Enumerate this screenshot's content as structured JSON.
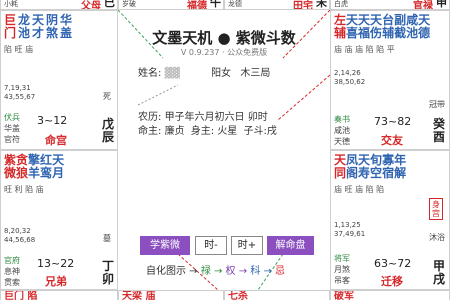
{
  "top_strip": {
    "left_label": "小耗",
    "left_palace": "父母",
    "left_stem": "巳",
    "mid_label": "岁破",
    "mid_palace": "福德",
    "mid_stem": "午",
    "right_label": "龙德",
    "right_palace": "田宅",
    "right_stem": "未",
    "far_label": "白虎",
    "far_palace": "官禄",
    "far_stem": "申"
  },
  "cells": {
    "ming": {
      "stars_red": [
        "巨",
        "门"
      ],
      "stars_blue": [
        "龙",
        "池"
      ],
      "stars_purple": [
        "天",
        "才"
      ],
      "stars_extra1": [
        "阴",
        "煞"
      ],
      "stars_extra2": [
        "华",
        "盖"
      ],
      "bright": "陷 旺    庙",
      "ages": [
        "7,19,31",
        "43,55,67"
      ],
      "right_label": "死",
      "shen1": "伏兵",
      "shen2": "华盖",
      "shen3": "官符",
      "range": "3~12",
      "palace": "命宫",
      "stem": [
        "戊",
        "辰"
      ]
    },
    "xiongdi": {
      "row1": [
        "紫",
        "贪",
        "擎",
        "红",
        "天"
      ],
      "row2": [
        "微",
        "狼",
        "羊",
        "鸾",
        "月"
      ],
      "row3": "旺 利 陷    庙",
      "ages": [
        "8,20,32",
        "44,56,68"
      ],
      "right_label": "墓",
      "shen1": "官府",
      "shen2": "息神",
      "shen3": "贯索",
      "range": "13~22",
      "palace": "兄弟",
      "stem": [
        "丁",
        "卯"
      ]
    },
    "guanlu": {
      "row1": [
        "左",
        "天",
        "天",
        "天",
        "台",
        "副",
        "咸",
        "天"
      ],
      "row2": [
        "辅",
        "喜",
        "福",
        "伤",
        "辅",
        "截",
        "池",
        "德"
      ],
      "row3": "庙 庙 庙    陷 陷 平",
      "ages": [
        "2,14,26",
        "38,50,62"
      ],
      "right_label": "冠带",
      "shen1": "奏书",
      "shen2": "咸池",
      "shen3": "天德",
      "range": "73~82",
      "palace": "交友",
      "stem": [
        "癸",
        "酉"
      ]
    },
    "qianyi": {
      "row1": [
        "天",
        "凤",
        "天",
        "旬",
        "寡",
        "年"
      ],
      "row2": [
        "同",
        "阁",
        "寿",
        "空",
        "宿",
        "解"
      ],
      "row3": "庙 旺 庙    陷 陷",
      "ages": [
        "1,13,25",
        "37,49,61"
      ],
      "right_label": "沐浴",
      "shen1": "将军",
      "shen2": "月煞",
      "shen3": "吊客",
      "range": "63~72",
      "palace": "迁移",
      "stem": [
        "甲",
        "戌"
      ],
      "badge": "身宫"
    }
  },
  "center": {
    "title": "文墨天机 ● 紫微斗数",
    "version": "V 0.9.237 · 公众免费版",
    "name_label": "姓名:",
    "name_value": "▓▓",
    "gender": "阳女",
    "wuxing": "木三局",
    "lunar_label": "农历:",
    "lunar_value": "甲子年六月初六日 卯时",
    "master_label": "命主:",
    "master_value": "廉贞",
    "body_label": "身主:",
    "body_value": "火星",
    "doushu_value": "子斗:戌",
    "buttons": {
      "xue": "学紫微",
      "minus": "时-",
      "plus": "时+",
      "jie": "解命盘"
    },
    "legend": {
      "label": "自化图示 →",
      "lu": "禄",
      "quan": "权",
      "ke": "科",
      "ji": "忌",
      "arrow": " → "
    }
  },
  "bottom_strip": {
    "a": "巨门 陷",
    "b": "天梁 庙",
    "c": "七杀",
    "d": "破军"
  },
  "colors": {
    "red": "#d6282a",
    "blue": "#2f64b1",
    "purple": "#8b4fc0",
    "green": "#2b8a3e"
  }
}
